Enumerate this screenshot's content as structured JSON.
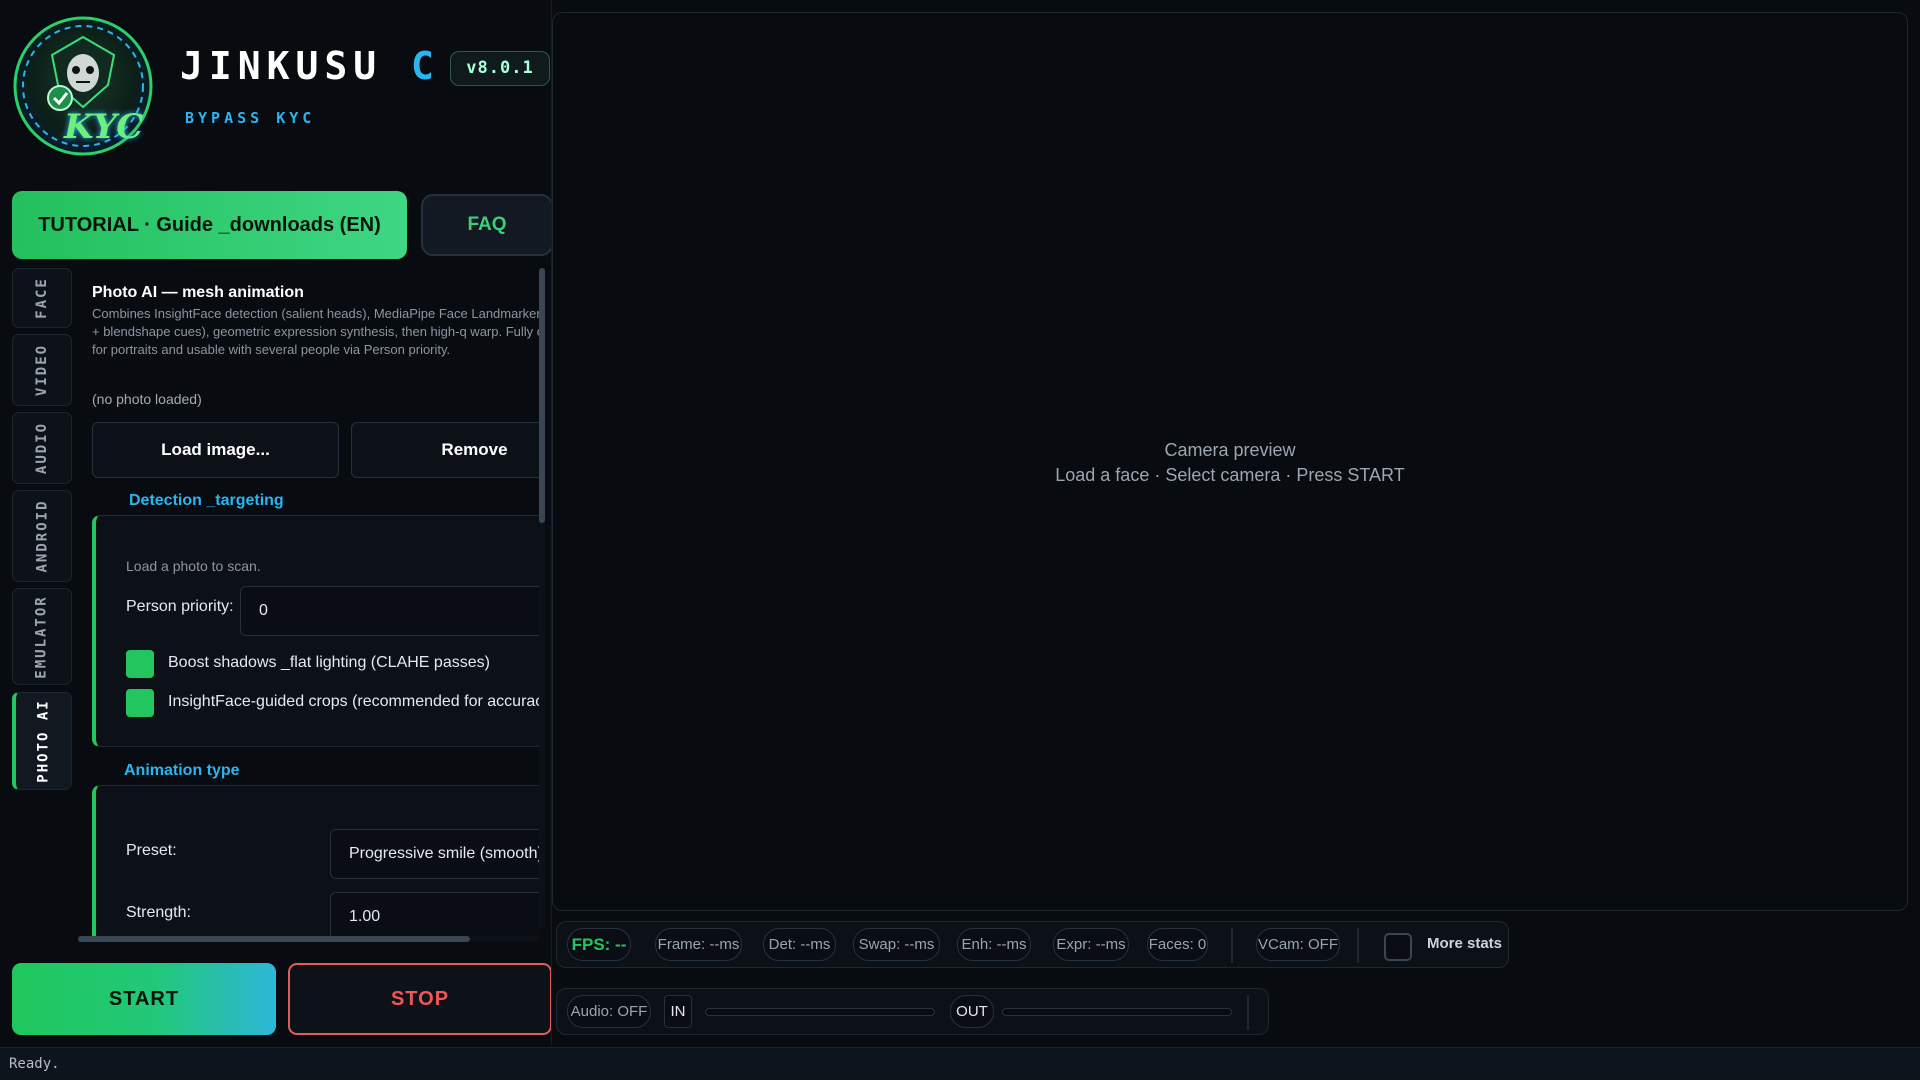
{
  "app": {
    "title_main": "JINKUSU ",
    "title_accent": "CAM",
    "version": "v8.0.1",
    "subtitle": "BYPASS KYC",
    "logo_text": "KYC"
  },
  "top_buttons": {
    "tutorial": "TUTORIAL  ·  Guide _downloads (EN)",
    "faq": "FAQ"
  },
  "side_tabs": [
    "FACE",
    "VIDEO",
    "AUDIO",
    "ANDROID",
    "EMULATOR",
    "PHOTO AI"
  ],
  "active_tab": "PHOTO AI",
  "photo_ai": {
    "title": "Photo AI — mesh animation",
    "description": "Combines InsightFace detection (salient heads), MediaPipe Face Landmarker landmarks + blendshape cues), geometric expression synthesis, then high-q warp. Fully offline; tuned for portraits and usable with several people via Person priority.",
    "status": "(no photo loaded)",
    "load_button": "Load image...",
    "remove_button": "Remove"
  },
  "detection": {
    "title": "Detection _targeting",
    "hint": "Load a photo to scan.",
    "person_priority_label": "Person priority:",
    "person_priority_value": "0",
    "boost_label": "Boost shadows _flat lighting (CLAHE passes)",
    "boost_checked": true,
    "crops_label": "InsightFace-guided crops (recommended for accuracy)",
    "crops_checked": true
  },
  "animation": {
    "title": "Animation type",
    "preset_label": "Preset:",
    "preset_value": "Progressive smile (smooth)",
    "strength_label": "Strength:",
    "strength_value": "1.00"
  },
  "controls": {
    "start": "START",
    "stop": "STOP"
  },
  "preview": {
    "title": "Camera preview",
    "hint": "Load a face  ·  Select camera  ·  Press START"
  },
  "stats": {
    "fps": "FPS: --",
    "frame": "Frame: --ms",
    "det": "Det: --ms",
    "swap": "Swap: --ms",
    "enh": "Enh: --ms",
    "expr": "Expr: --ms",
    "faces": "Faces: 0",
    "vcam": "VCam: OFF",
    "more_stats": "More stats",
    "more_stats_checked": false
  },
  "audio": {
    "status": "Audio: OFF",
    "in_label": "IN",
    "out_label": "OUT",
    "in_level": 0,
    "out_level": 0
  },
  "statusbar": {
    "text": "Ready."
  },
  "colors": {
    "accent_green": "#22c55e",
    "accent_cyan": "#2bb5f0",
    "stop_red": "#f05656",
    "background": "#080b10"
  }
}
